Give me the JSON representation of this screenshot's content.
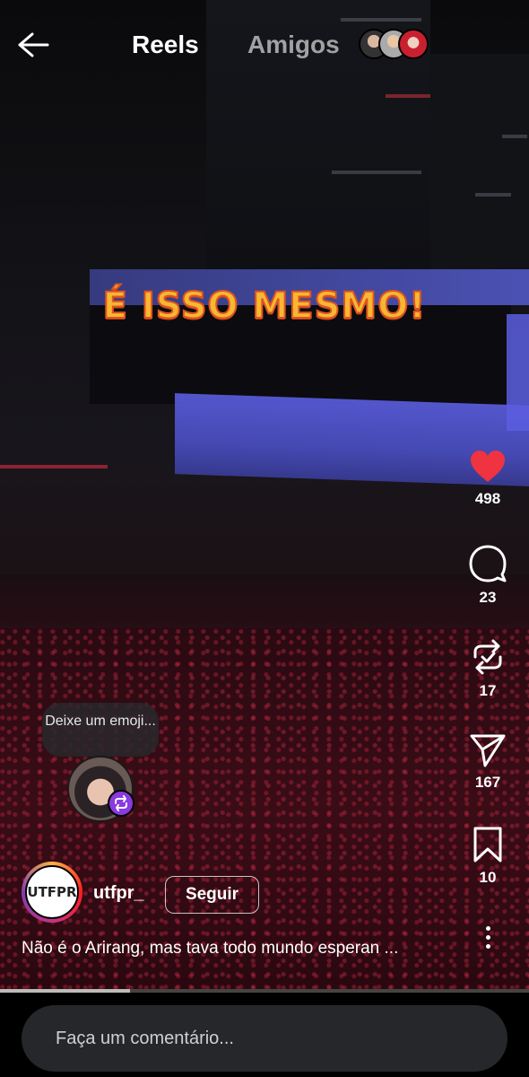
{
  "header": {
    "tab_reels": "Reels",
    "tab_amigos": "Amigos"
  },
  "overlay": {
    "caption": "É ISSO MESMO!"
  },
  "actions": {
    "likes": "498",
    "comments": "23",
    "remixes": "17",
    "shares": "167",
    "saves": "10"
  },
  "emoji_prompt": {
    "text": "Deixe um emoji..."
  },
  "post": {
    "username": "utfpr_",
    "follow_label": "Seguir",
    "avatar_text": "UTFPR",
    "caption": "Não é o Arirang, mas tava todo mundo esperan ..."
  },
  "playback": {
    "progress": 0.245
  },
  "comment_box": {
    "placeholder": "Faça um comentário..."
  },
  "colors": {
    "like": "#ef3340",
    "overlay_text": "#f7b733",
    "overlay_stroke": "#e0541e",
    "emoji_badge": "#8a3ae0"
  }
}
